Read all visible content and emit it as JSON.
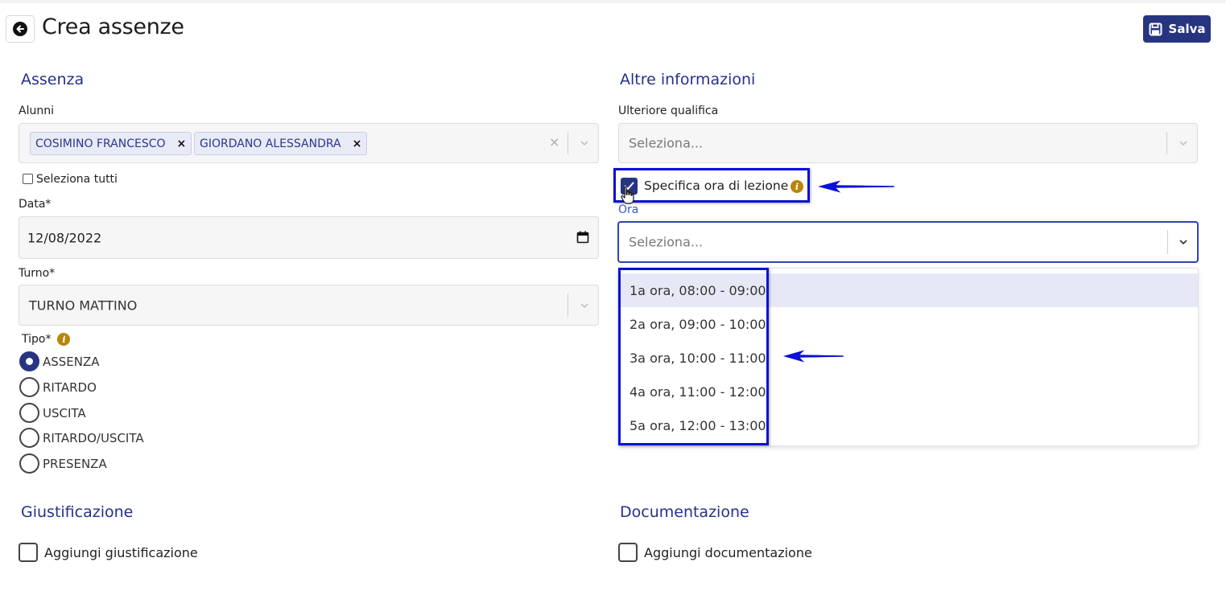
{
  "header": {
    "title": "Crea assenze",
    "save_label": "Salva"
  },
  "assenza": {
    "section_title": "Assenza",
    "alunni": {
      "label": "Alunni",
      "chips": [
        "COSIMINO FRANCESCO",
        "GIORDANO ALESSANDRA"
      ],
      "chip_remove": "×",
      "clear_symbol": "×"
    },
    "select_all_label": "Seleziona tutti",
    "data": {
      "label": "Data*",
      "value": "12/08/2022"
    },
    "turno": {
      "label": "Turno*",
      "value": "TURNO MATTINO"
    },
    "tipo": {
      "label": "Tipo*",
      "options": [
        "ASSENZA",
        "RITARDO",
        "USCITA",
        "RITARDO/USCITA",
        "PRESENZA"
      ],
      "selected": "ASSENZA"
    }
  },
  "altre": {
    "section_title": "Altre informazioni",
    "ulteriore": {
      "label": "Ulteriore qualifica",
      "placeholder": "Seleziona..."
    },
    "specifica": {
      "label": "Specifica ora di lezione",
      "checked": true
    },
    "ora": {
      "label": "Ora",
      "placeholder": "Seleziona...",
      "options": [
        "1a ora, 08:00 - 09:00",
        "2a ora, 09:00 - 10:00",
        "3a ora, 10:00 - 11:00",
        "4a ora, 11:00 - 12:00",
        "5a ora, 12:00 - 13:00"
      ],
      "highlighted_option": "1a ora, 08:00 - 09:00"
    }
  },
  "giustificazione": {
    "section_title": "Giustificazione",
    "checkbox_label": "Aggiungi giustificazione"
  },
  "documentazione": {
    "section_title": "Documentazione",
    "checkbox_label": "Aggiungi documentazione"
  },
  "icons": {
    "info": "i"
  },
  "colors": {
    "primary": "#273581",
    "accent_title": "#24318a",
    "annotation_blue": "#0a10d8",
    "info_icon": "#b8860b"
  }
}
